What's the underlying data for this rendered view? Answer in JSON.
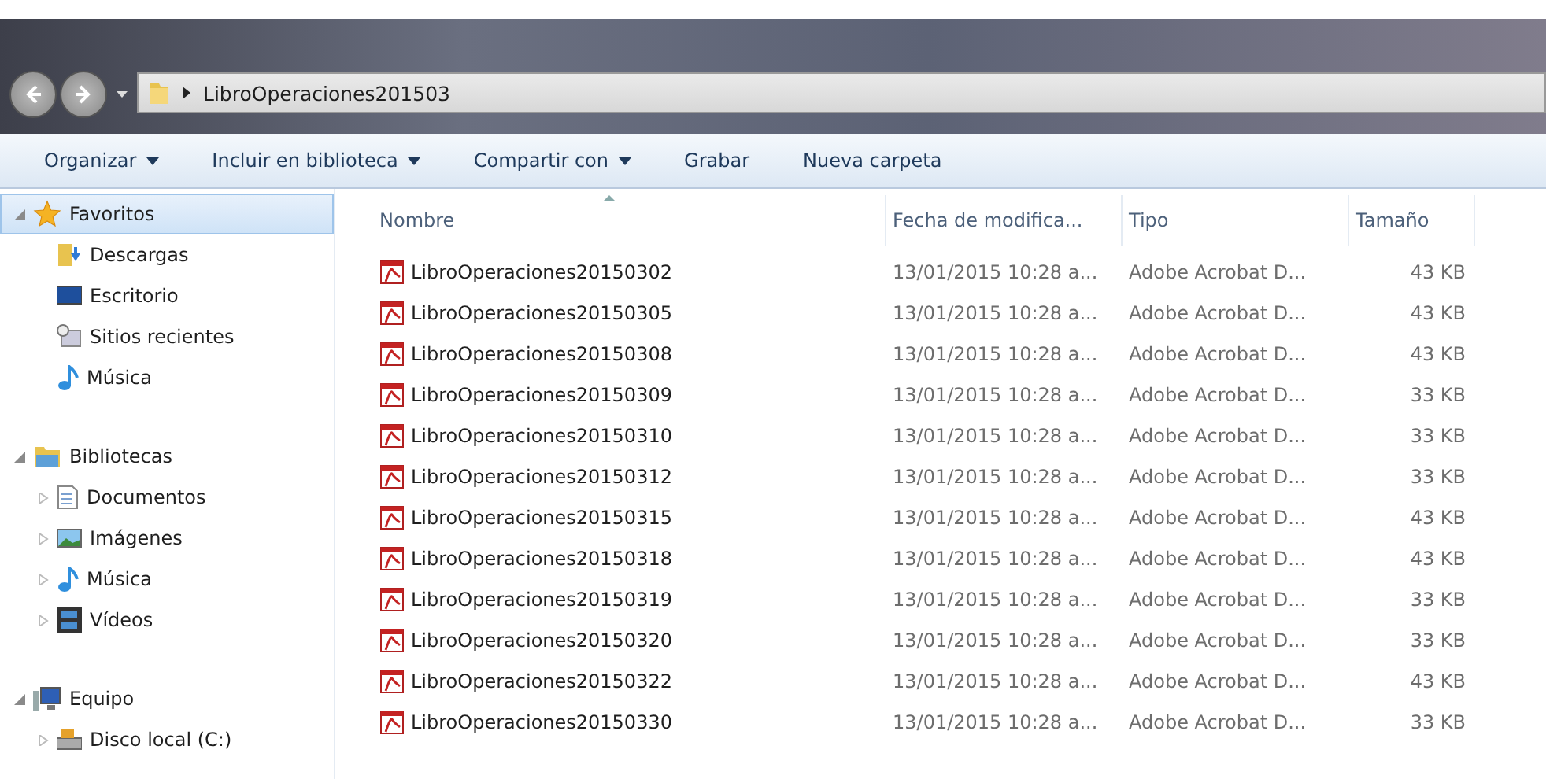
{
  "address_bar": {
    "path": "LibroOperaciones201503"
  },
  "toolbar": [
    {
      "label": "Organizar",
      "dropdown": true
    },
    {
      "label": "Incluir en biblioteca",
      "dropdown": true
    },
    {
      "label": "Compartir con",
      "dropdown": true
    },
    {
      "label": "Grabar",
      "dropdown": false
    },
    {
      "label": "Nueva carpeta",
      "dropdown": false
    }
  ],
  "sidebar": {
    "sections": [
      {
        "label": "Favoritos",
        "kind": "star",
        "expanded": true,
        "selected": true,
        "children": [
          {
            "label": "Descargas",
            "kind": "downloads"
          },
          {
            "label": "Escritorio",
            "kind": "desktop"
          },
          {
            "label": "Sitios recientes",
            "kind": "recent"
          },
          {
            "label": "Música",
            "kind": "music"
          }
        ]
      },
      {
        "label": "Bibliotecas",
        "kind": "libraries",
        "expanded": true,
        "selected": false,
        "children": [
          {
            "label": "Documentos",
            "kind": "document",
            "expanded": false
          },
          {
            "label": "Imágenes",
            "kind": "pictures",
            "expanded": false
          },
          {
            "label": "Música",
            "kind": "music",
            "expanded": false
          },
          {
            "label": "Vídeos",
            "kind": "videos",
            "expanded": false
          }
        ]
      },
      {
        "label": "Equipo",
        "kind": "computer",
        "expanded": true,
        "selected": false,
        "children": [
          {
            "label": "Disco local (C:)",
            "kind": "drive",
            "expanded": false
          }
        ]
      }
    ]
  },
  "table": {
    "columns": [
      {
        "label": "Nombre",
        "sorted": true
      },
      {
        "label": "Fecha de modifica...",
        "sorted": false
      },
      {
        "label": "Tipo",
        "sorted": false
      },
      {
        "label": "Tamaño",
        "sorted": false
      }
    ],
    "rows": [
      {
        "name": "LibroOperaciones20150302",
        "date": "13/01/2015 10:28 a...",
        "type": "Adobe Acrobat D...",
        "size": "43 KB"
      },
      {
        "name": "LibroOperaciones20150305",
        "date": "13/01/2015 10:28 a...",
        "type": "Adobe Acrobat D...",
        "size": "43 KB"
      },
      {
        "name": "LibroOperaciones20150308",
        "date": "13/01/2015 10:28 a...",
        "type": "Adobe Acrobat D...",
        "size": "43 KB"
      },
      {
        "name": "LibroOperaciones20150309",
        "date": "13/01/2015 10:28 a...",
        "type": "Adobe Acrobat D...",
        "size": "33 KB"
      },
      {
        "name": "LibroOperaciones20150310",
        "date": "13/01/2015 10:28 a...",
        "type": "Adobe Acrobat D...",
        "size": "33 KB"
      },
      {
        "name": "LibroOperaciones20150312",
        "date": "13/01/2015 10:28 a...",
        "type": "Adobe Acrobat D...",
        "size": "33 KB"
      },
      {
        "name": "LibroOperaciones20150315",
        "date": "13/01/2015 10:28 a...",
        "type": "Adobe Acrobat D...",
        "size": "43 KB"
      },
      {
        "name": "LibroOperaciones20150318",
        "date": "13/01/2015 10:28 a...",
        "type": "Adobe Acrobat D...",
        "size": "43 KB"
      },
      {
        "name": "LibroOperaciones20150319",
        "date": "13/01/2015 10:28 a...",
        "type": "Adobe Acrobat D...",
        "size": "33 KB"
      },
      {
        "name": "LibroOperaciones20150320",
        "date": "13/01/2015 10:28 a...",
        "type": "Adobe Acrobat D...",
        "size": "33 KB"
      },
      {
        "name": "LibroOperaciones20150322",
        "date": "13/01/2015 10:28 a...",
        "type": "Adobe Acrobat D...",
        "size": "43 KB"
      },
      {
        "name": "LibroOperaciones20150330",
        "date": "13/01/2015 10:28 a...",
        "type": "Adobe Acrobat D...",
        "size": "33 KB"
      }
    ]
  }
}
